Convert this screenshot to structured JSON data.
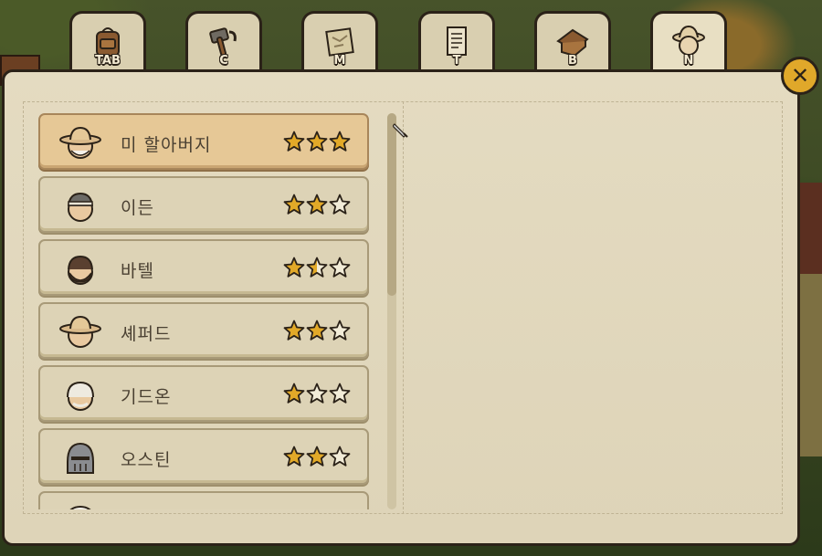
{
  "tabs": [
    {
      "key": "TAB",
      "icon": "backpack-icon"
    },
    {
      "key": "C",
      "icon": "hammer-icon"
    },
    {
      "key": "M",
      "icon": "map-icon"
    },
    {
      "key": "T",
      "icon": "document-icon"
    },
    {
      "key": "B",
      "icon": "house-icon"
    },
    {
      "key": "N",
      "icon": "villager-icon",
      "active": true
    }
  ],
  "close": {
    "label": "✕"
  },
  "villagers": [
    {
      "name": "미 할아버지",
      "stars": 3,
      "avatar": "farmer-hat-elder-avatar",
      "selected": true
    },
    {
      "name": "이든",
      "stars": 2,
      "avatar": "headband-man-avatar"
    },
    {
      "name": "바텔",
      "stars": 1.5,
      "avatar": "bearded-man-avatar"
    },
    {
      "name": "셰퍼드",
      "stars": 2,
      "avatar": "farmer-hat-avatar"
    },
    {
      "name": "기드온",
      "stars": 1,
      "avatar": "white-haired-elder-avatar"
    },
    {
      "name": "오스틴",
      "stars": 2,
      "avatar": "knight-helmet-avatar"
    },
    {
      "name": "",
      "stars": 0,
      "avatar": "chef-hat-avatar"
    }
  ],
  "colors": {
    "star_fill": "#e2a928",
    "star_empty": "#f2ecd8",
    "outline": "#2b2218",
    "selected_row": "#e6c896"
  }
}
